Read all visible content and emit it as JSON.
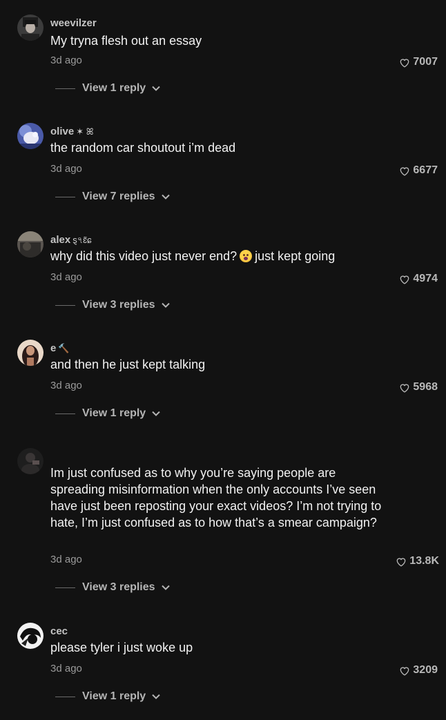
{
  "comments": [
    {
      "username": "weevilzer",
      "decor": "",
      "text": "My tryna flesh out an essay",
      "time": "3d ago",
      "likes": "7007",
      "replies_label": "View 1 reply"
    },
    {
      "username": "olive",
      "decor": "✶ ꕤ",
      "text": "the random car shoutout i’m dead",
      "time": "3d ago",
      "likes": "6677",
      "replies_label": "View 7 replies"
    },
    {
      "username": "alex",
      "decor": "ȿ৭ɛ̃ɕ",
      "text_before": "why did this video just never end?",
      "emoji": "face-screaming-emoji",
      "text_after": "just kept going",
      "time": "3d ago",
      "likes": "4974",
      "replies_label": "View 3 replies"
    },
    {
      "username": "e",
      "decor": "🔨",
      "text": "and then he just kept talking",
      "time": "3d ago",
      "likes": "5968",
      "replies_label": "View 1 reply"
    },
    {
      "username": "",
      "decor": "",
      "text": "Im just confused as to why you’re saying people are spreading misinformation when the only accounts I’ve seen have just been reposting your exact videos? I’m not trying to hate, I’m just confused as to how that’s a smear campaign?",
      "time": "3d ago",
      "likes": "13.8K",
      "replies_label": "View 3 replies"
    },
    {
      "username": "cec",
      "decor": "",
      "text": "please tyler i just woke up",
      "time": "3d ago",
      "likes": "3209",
      "replies_label": "View 1 reply"
    }
  ],
  "icons": {
    "like": "heart-outline-icon",
    "expand": "chevron-down-icon"
  },
  "colors": {
    "background": "#121212",
    "text": "#f2f2f2",
    "muted": "#9a9a9a"
  }
}
